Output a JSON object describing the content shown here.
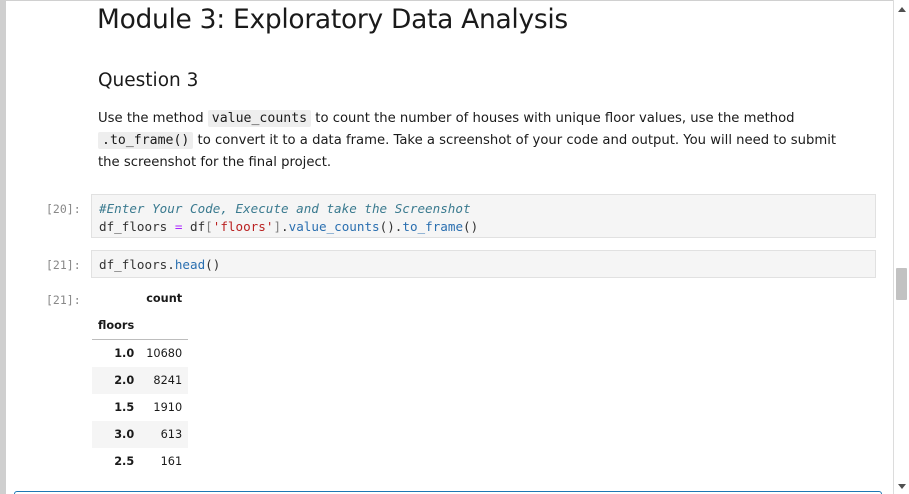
{
  "markdown": {
    "title": "Module 3: Exploratory Data Analysis",
    "subtitle": "Question 3",
    "paragraph": {
      "text1": "Use the method ",
      "code1": "value_counts",
      "text2": " to count the number of houses with unique floor values, use the method",
      "code2": ".to_frame()",
      "text3": " to convert it to a data frame. Take a screenshot of your code and output. You will need to submit the screenshot for the final project."
    }
  },
  "cells": [
    {
      "prompt": "[20]:",
      "lines": [
        "#Enter Your Code, Execute and take the Screenshot",
        "df_floors = df['floors'].value_counts().to_frame()"
      ]
    },
    {
      "prompt": "[21]:",
      "lines": [
        "df_floors.head()"
      ]
    }
  ],
  "output": {
    "prompt": "[21]:",
    "table": {
      "column_header": "count",
      "index_name": "floors",
      "rows": [
        {
          "index": "1.0",
          "value": "10680"
        },
        {
          "index": "2.0",
          "value": "8241"
        },
        {
          "index": "1.5",
          "value": "1910"
        },
        {
          "index": "3.0",
          "value": "613"
        },
        {
          "index": "2.5",
          "value": "161"
        }
      ]
    }
  },
  "icons": {
    "scroll_up": "chevron-up-icon",
    "scroll_down": "chevron-down-icon"
  },
  "colors": {
    "selected_cell_border": "#1f77b4",
    "comment": "#3a7a8f",
    "string": "#ba2121"
  }
}
